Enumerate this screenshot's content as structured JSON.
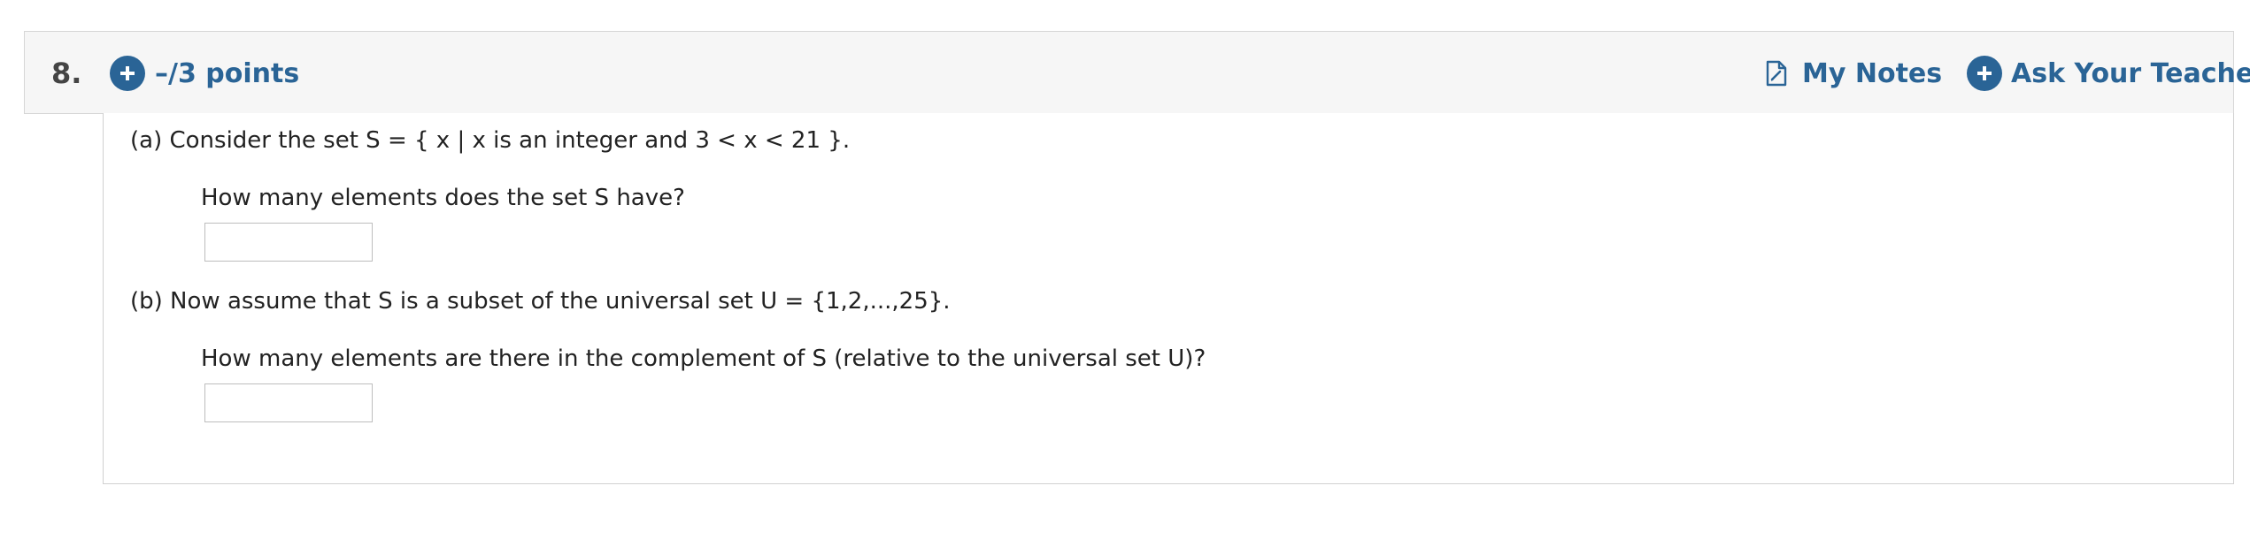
{
  "question": {
    "number": "8.",
    "points_label": "–/3 points",
    "my_notes_label": "My Notes",
    "ask_teacher_label": "Ask Your Teacher"
  },
  "part_a": {
    "statement": "(a) Consider the set S = { x | x is an integer and 3 < x < 21 }.",
    "prompt": "How many elements does the set S have?",
    "answer_value": ""
  },
  "part_b": {
    "statement": "(b) Now assume that S is a subset of the universal set U = {1,2,...,25}.",
    "prompt": "How many elements are there in the complement of S (relative to the universal set U)?",
    "answer_value": ""
  },
  "icons": {
    "points_icon": "plus-circle-icon",
    "notes_icon": "notes-document-icon",
    "ask_icon": "plus-circle-icon"
  },
  "colors": {
    "accent": "#2a6496",
    "header_background": "#f6f6f6",
    "border": "#d0d0d0"
  }
}
